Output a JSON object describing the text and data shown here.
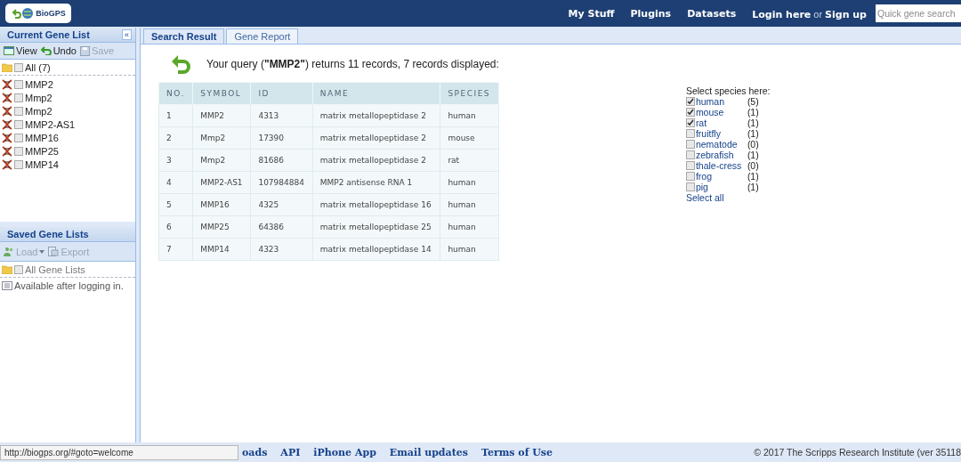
{
  "logo": {
    "text": "BioGPS"
  },
  "nav": [
    {
      "label": "My Stuff"
    },
    {
      "label": "Plugins"
    },
    {
      "label": "Datasets"
    }
  ],
  "login": {
    "login": "Login here",
    "or": "or",
    "signup": "Sign up"
  },
  "search": {
    "placeholder": "Quick gene search"
  },
  "current_list": {
    "title": "Current Gene List",
    "collapse": "«",
    "toolbar": [
      {
        "label": "View",
        "disabled": false,
        "kind": "view"
      },
      {
        "label": "Undo",
        "disabled": false,
        "kind": "undo"
      },
      {
        "label": "Save",
        "disabled": true,
        "kind": "save"
      }
    ],
    "all": {
      "label": "All (7)",
      "checked": false
    },
    "genes": [
      {
        "label": "MMP2",
        "checked": false
      },
      {
        "label": "Mmp2",
        "checked": false
      },
      {
        "label": "Mmp2",
        "checked": false
      },
      {
        "label": "MMP2-AS1",
        "checked": false
      },
      {
        "label": "MMP16",
        "checked": false
      },
      {
        "label": "MMP25",
        "checked": false
      },
      {
        "label": "MMP14",
        "checked": false
      }
    ]
  },
  "saved_lists": {
    "title": "Saved Gene Lists",
    "toolbar": [
      {
        "label": "Load",
        "disabled": true,
        "kind": "load"
      },
      {
        "label": "Export",
        "disabled": true,
        "kind": "export"
      }
    ],
    "all": {
      "label": "All Gene Lists",
      "checked": false
    },
    "note": "Available after logging in."
  },
  "tabs": [
    {
      "label": "Search Result",
      "selected": true
    },
    {
      "label": "Gene Report",
      "selected": false
    }
  ],
  "query": "Your query (**\"MMP2\"**) returns 11 records, 7 records displayed:",
  "table": {
    "columns": [
      "NO.",
      "SYMBOL",
      "ID",
      "NAME",
      "SPECIES"
    ],
    "rows": [
      [
        "1",
        "MMP2",
        "4313",
        "matrix metallopeptidase 2",
        "human"
      ],
      [
        "2",
        "Mmp2",
        "17390",
        "matrix metallopeptidase 2",
        "mouse"
      ],
      [
        "3",
        "Mmp2",
        "81686",
        "matrix metallopeptidase 2",
        "rat"
      ],
      [
        "4",
        "MMP2-AS1",
        "107984884",
        "MMP2 antisense RNA 1",
        "human"
      ],
      [
        "5",
        "MMP16",
        "4325",
        "matrix metallopeptidase 16",
        "human"
      ],
      [
        "6",
        "MMP25",
        "64386",
        "matrix metallopeptidase 25",
        "human"
      ],
      [
        "7",
        "MMP14",
        "4323",
        "matrix metallopeptidase 14",
        "human"
      ]
    ]
  },
  "species": {
    "title": "Select species here:",
    "items": [
      {
        "name": "human",
        "count": "(5)",
        "checked": true
      },
      {
        "name": "mouse",
        "count": "(1)",
        "checked": true
      },
      {
        "name": "rat",
        "count": "(1)",
        "checked": true
      },
      {
        "name": "fruitfly",
        "count": "(1)",
        "checked": false
      },
      {
        "name": "nematode",
        "count": "(0)",
        "checked": false
      },
      {
        "name": "zebrafish",
        "count": "(1)",
        "checked": false
      },
      {
        "name": "thale-cress",
        "count": "(0)",
        "checked": false
      },
      {
        "name": "frog",
        "count": "(1)",
        "checked": false
      },
      {
        "name": "pig",
        "count": "(1)",
        "checked": false
      }
    ],
    "select_all": "Select all"
  },
  "footer": {
    "links": [
      "oads",
      "API",
      "iPhone App",
      "Email updates",
      "Terms of Use"
    ],
    "copyright": "© 2017 The Scripps Research Institute (ver 35118"
  },
  "status_url": "http://biogps.org/#goto=welcome"
}
